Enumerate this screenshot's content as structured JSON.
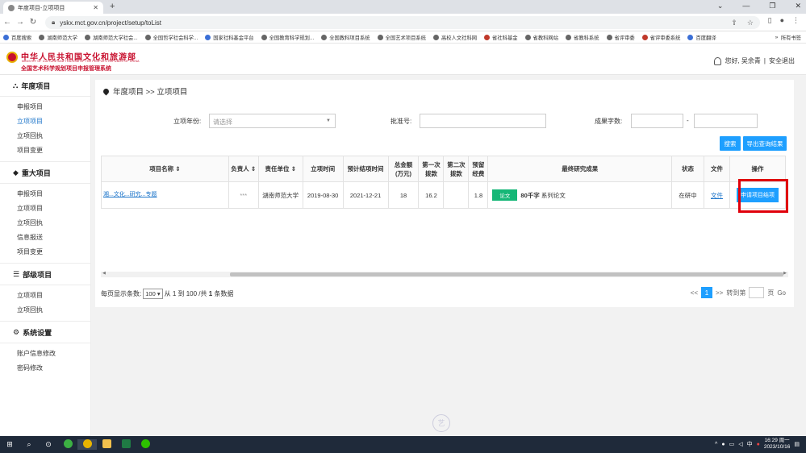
{
  "browser": {
    "tab_title": "年度项目-立项项目",
    "url": "yskx.mct.gov.cn/project/setup/toList",
    "bookmarks": [
      "百度搜索",
      "湖南师范大学",
      "湖南师范大学社会...",
      "全国哲学社会科学...",
      "国家社科基金平台",
      "全国教育科学规划...",
      "全国教科项目系统",
      "全国艺术项目系统",
      "高校人文社科网",
      "省社科基金",
      "省教科网站",
      "省教科系统",
      "省评审委",
      "省评审委系统",
      "百度翻译"
    ],
    "all_bookmarks": "所有书签"
  },
  "header": {
    "logo_title": "中华人民共和国文化和旅游部",
    "logo_subtitle": "MINISTRY OF CULTURE AND TOURISM OF THE PEOPLE'S REPUBLIC OF CHINA",
    "system_name": "全国艺术科学规划项目申报管理系统",
    "greeting": "您好, 吴余青",
    "logout": "安全退出"
  },
  "sidebar": {
    "sections": [
      {
        "title": "年度项目",
        "items": [
          "申报项目",
          "立项项目",
          "立项回执",
          "项目变更"
        ]
      },
      {
        "title": "重大项目",
        "items": [
          "申报项目",
          "立项项目",
          "立项回执",
          "信息报送",
          "项目变更"
        ]
      },
      {
        "title": "部级项目",
        "items": [
          "立项项目",
          "立项回执"
        ]
      },
      {
        "title": "系统设置",
        "items": [
          "账户信息修改",
          "密码修改"
        ]
      }
    ]
  },
  "breadcrumb": "年度项目 >> 立项项目",
  "filters": {
    "year_label": "立项年份:",
    "year_placeholder": "请选择",
    "approval_label": "批准号:",
    "words_label": "成果字数:",
    "dash": "-",
    "search": "搜索",
    "export": "导出查询结果"
  },
  "table": {
    "headers": [
      "项目名称",
      "负责人",
      "责任单位",
      "立项时间",
      "预计结项时间",
      "总金额\n(万元)",
      "第一次\n拨款",
      "第二次\n拨款",
      "预留\n经费",
      "最终研究成果",
      "状态",
      "文件",
      "操作"
    ],
    "row": {
      "name": "湘...文化...研究...专题",
      "leader": "***",
      "unit": "湖南师范大学",
      "setup_date": "2019-08-30",
      "end_date": "2021-12-21",
      "total": "18",
      "first": "16.2",
      "second": "",
      "reserve": "1.8",
      "result_tag": "论文",
      "result_words": "80千字",
      "result_text": "系列论文",
      "status": "在研中",
      "file": "文件",
      "action": "申请项目结项"
    }
  },
  "pagination": {
    "per_page_label": "每页显示条数:",
    "per_page": "100",
    "summary_pre": "从 1 到 100 /共",
    "summary_count": "1",
    "summary_post": "条数据",
    "prev": "<<",
    "page": "1",
    "next": ">>",
    "goto": "转到第",
    "page_unit": "页",
    "go": "Go"
  },
  "taskbar": {
    "time": "16:29 周一",
    "date": "2023/10/16"
  }
}
